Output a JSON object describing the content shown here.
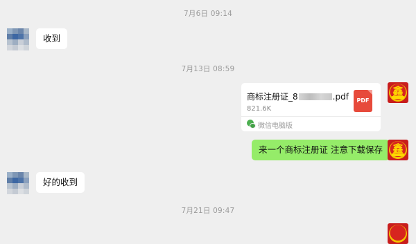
{
  "timestamps": [
    "7月6日 09:14",
    "7月13日 08:59",
    "7月21日 09:47"
  ],
  "messages": [
    {
      "side": "left",
      "text": "收到"
    },
    {
      "side": "right",
      "type": "file",
      "file_name_prefix": "商标注册证_8",
      "file_name_suffix": ".pdf",
      "file_size": "821.6K",
      "file_icon_label": "PDF",
      "source": "微信电脑版"
    },
    {
      "side": "right",
      "text": "来一个商标注册证 注意下载保存"
    },
    {
      "side": "left",
      "text": "好的收到"
    }
  ],
  "colors": {
    "background": "#efefef",
    "self_bubble": "#95ec69",
    "other_bubble": "#ffffff",
    "pdf": "#e74a3b"
  },
  "icons": {
    "file": "pdf-file-icon",
    "source": "wechat-icon"
  }
}
